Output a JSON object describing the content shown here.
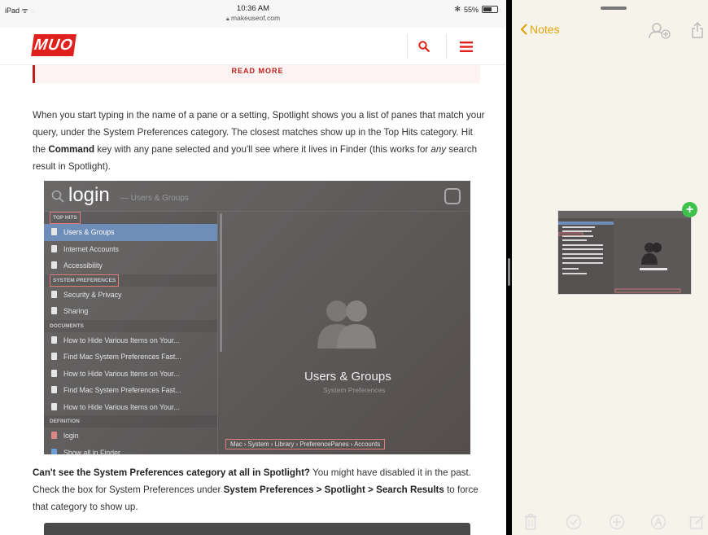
{
  "status_bar": {
    "device": "iPad",
    "time": "10:36 AM",
    "url": "makeuseof.com",
    "battery": "55%",
    "bluetooth": "✻"
  },
  "site": {
    "logo": "MUO",
    "read_more": "READ MORE",
    "accent": "#e0201c"
  },
  "article": {
    "para1": [
      {
        "t": "When you start typing in the name of a pane or a setting, Spotlight shows you a list of panes that match your query, under the System Preferences category. The closest matches show up in the Top Hits category. Hit the "
      },
      {
        "t": "Command",
        "b": true
      },
      {
        "t": " key with any pane selected and you'll see where it lives in Finder (this works for "
      },
      {
        "t": "any",
        "i": true
      },
      {
        "t": " search result in Spotlight)."
      }
    ],
    "para2": [
      {
        "t": "Can't see the System Preferences category at all in Spotlight?",
        "b": true
      },
      {
        "t": " You might have disabled it in the past. Check the box for System Preferences under "
      },
      {
        "t": "System Preferences > Spotlight > Search Results",
        "b": true
      },
      {
        "t": " to force that category to show up."
      }
    ]
  },
  "spotlight": {
    "query": "login",
    "query_sub": "— Users & Groups",
    "sections": [
      {
        "title": "TOP HITS",
        "highlight": true,
        "rows": [
          {
            "label": "Users & Groups",
            "selected": true
          },
          {
            "label": "Internet Accounts"
          },
          {
            "label": "Accessibility"
          }
        ]
      },
      {
        "title": "SYSTEM PREFERENCES",
        "highlight": true,
        "rows": [
          {
            "label": "Security & Privacy"
          },
          {
            "label": "Sharing"
          }
        ]
      },
      {
        "title": "DOCUMENTS",
        "rows": [
          {
            "label": "How to Hide Various Items on Your..."
          },
          {
            "label": "Find Mac System Preferences Fast..."
          },
          {
            "label": "How to Hide Various Items on Your..."
          },
          {
            "label": "Find Mac System Preferences Fast..."
          },
          {
            "label": "How to Hide Various Items on Your..."
          }
        ]
      },
      {
        "title": "DEFINITION",
        "rows": [
          {
            "label": "login",
            "kind": "def"
          },
          {
            "label": "Show all in Finder...",
            "kind": "fin"
          }
        ]
      }
    ],
    "preview_title": "Users & Groups",
    "preview_subtitle": "System Preferences",
    "path": "Mac › System › Library › PreferencePanes › Accounts"
  },
  "notes": {
    "back_label": "Notes",
    "accent": "#e0a40e",
    "add_badge": "+"
  }
}
